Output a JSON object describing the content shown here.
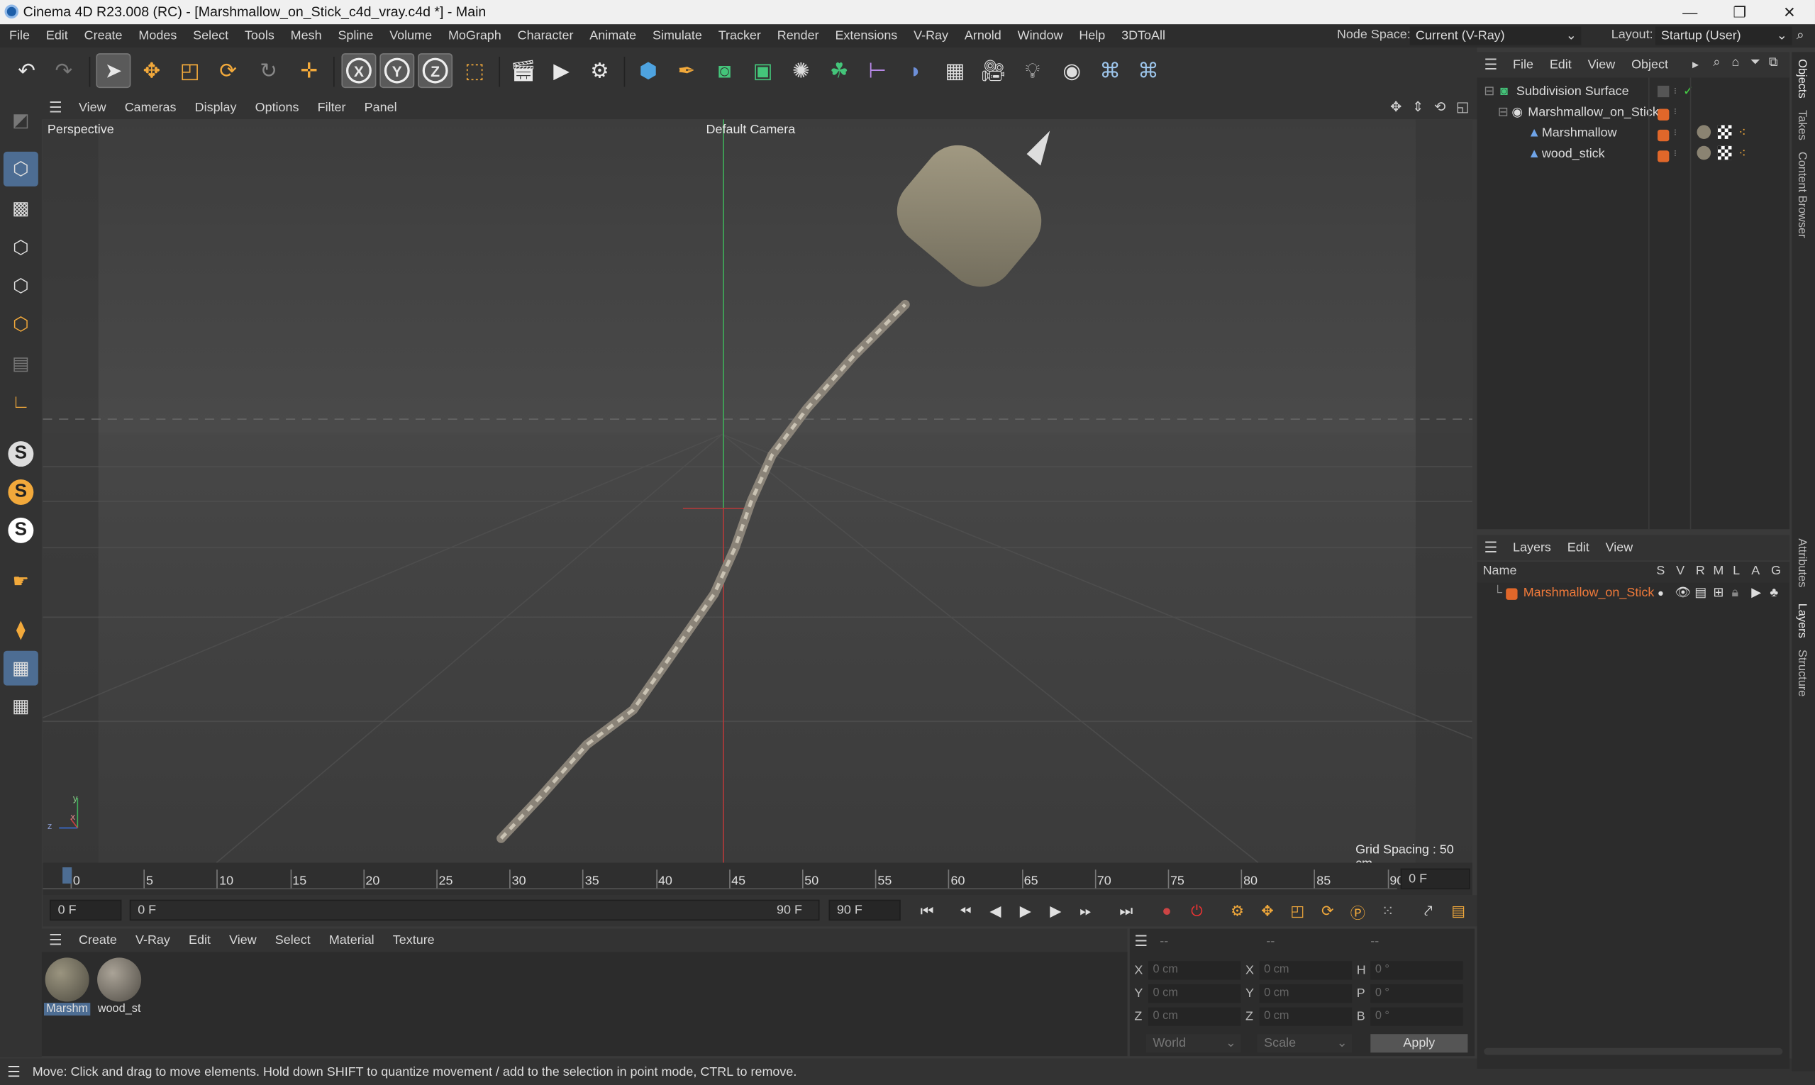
{
  "window": {
    "title": "Cinema 4D R23.008 (RC) - [Marshmallow_on_Stick_c4d_vray.c4d *] - Main",
    "minimize": "—",
    "restore": "❐",
    "close": "✕"
  },
  "menubar": {
    "items": [
      "File",
      "Edit",
      "Create",
      "Modes",
      "Select",
      "Tools",
      "Mesh",
      "Spline",
      "Volume",
      "MoGraph",
      "Character",
      "Animate",
      "Simulate",
      "Tracker",
      "Render",
      "Extensions",
      "V-Ray",
      "Arnold",
      "Window",
      "Help",
      "3DToAll"
    ],
    "node_space_label": "Node Space:",
    "node_space_value": "Current (V-Ray)",
    "layout_label": "Layout:",
    "layout_value": "Startup (User)"
  },
  "toolbar": {
    "icons": [
      "undo-icon",
      "redo-icon",
      "select-icon",
      "move-icon",
      "scale-icon",
      "rotate-icon",
      "recent-tool-icon",
      "add-icon",
      "x-axis-icon",
      "y-axis-icon",
      "z-axis-icon",
      "world-coord-icon",
      "render-region-icon",
      "render-view-icon",
      "render-settings-icon",
      "cube-icon",
      "pen-icon",
      "subdivision-icon",
      "extrude-icon",
      "cloner-icon",
      "deformer-icon",
      "measure-icon",
      "sky-icon",
      "floor-icon",
      "camera-icon",
      "light-icon",
      "vray-icon",
      "python-icon",
      "python2-icon"
    ],
    "axis_labels": {
      "x": "X",
      "y": "Y",
      "z": "Z"
    }
  },
  "viewport": {
    "menu": [
      "View",
      "Cameras",
      "Display",
      "Options",
      "Filter",
      "Panel"
    ],
    "projection": "Perspective",
    "camera": "Default Camera",
    "grid_spacing": "Grid Spacing : 50 cm",
    "axis_labels": {
      "x": "x",
      "y": "y",
      "z": "z"
    }
  },
  "timeline": {
    "ticks": [
      "0",
      "5",
      "10",
      "15",
      "20",
      "25",
      "30",
      "35",
      "40",
      "45",
      "50",
      "55",
      "60",
      "65",
      "70",
      "75",
      "80",
      "85",
      "90"
    ],
    "end_field": "0 F"
  },
  "transport": {
    "start": "0 F",
    "range_start": "0 F",
    "range_end": "90 F",
    "end": "90 F"
  },
  "materials": {
    "menu": [
      "Create",
      "V-Ray",
      "Edit",
      "View",
      "Select",
      "Material",
      "Texture"
    ],
    "items": [
      {
        "name": "Marshm",
        "color": "#7c7766"
      },
      {
        "name": "wood_st",
        "color": "#8a8478"
      }
    ]
  },
  "coords": {
    "rows": [
      {
        "a": "X",
        "av": "0 cm",
        "b": "X",
        "bv": "0 cm",
        "c": "H",
        "cv": "0 °"
      },
      {
        "a": "Y",
        "av": "0 cm",
        "b": "Y",
        "bv": "0 cm",
        "c": "P",
        "cv": "0 °"
      },
      {
        "a": "Z",
        "av": "0 cm",
        "b": "Z",
        "bv": "0 cm",
        "c": "B",
        "cv": "0 °"
      }
    ],
    "mode": "World",
    "scale": "Scale",
    "apply": "Apply",
    "header_dashes": [
      "--",
      "--",
      "--"
    ]
  },
  "status": "Move: Click and drag to move elements. Hold down SHIFT to quantize movement / add to the selection in point mode, CTRL to remove.",
  "objects": {
    "menu": [
      "File",
      "Edit",
      "View",
      "Object"
    ],
    "items": [
      {
        "name": "Subdivision Surface",
        "indent": 0
      },
      {
        "name": "Marshmallow_on_Stick",
        "indent": 1
      },
      {
        "name": "Marshmallow",
        "indent": 2
      },
      {
        "name": "wood_stick",
        "indent": 2
      }
    ]
  },
  "layers": {
    "menu": [
      "Layers",
      "Edit",
      "View"
    ],
    "columns": [
      "Name",
      "S",
      "V",
      "R",
      "M",
      "L",
      "A",
      "G"
    ],
    "items": [
      {
        "name": "Marshmallow_on_Stick",
        "color": "#e0672a"
      }
    ]
  },
  "sidetabs": [
    "Objects",
    "Takes",
    "Content Browser",
    "Attributes",
    "Layers",
    "Structure"
  ]
}
